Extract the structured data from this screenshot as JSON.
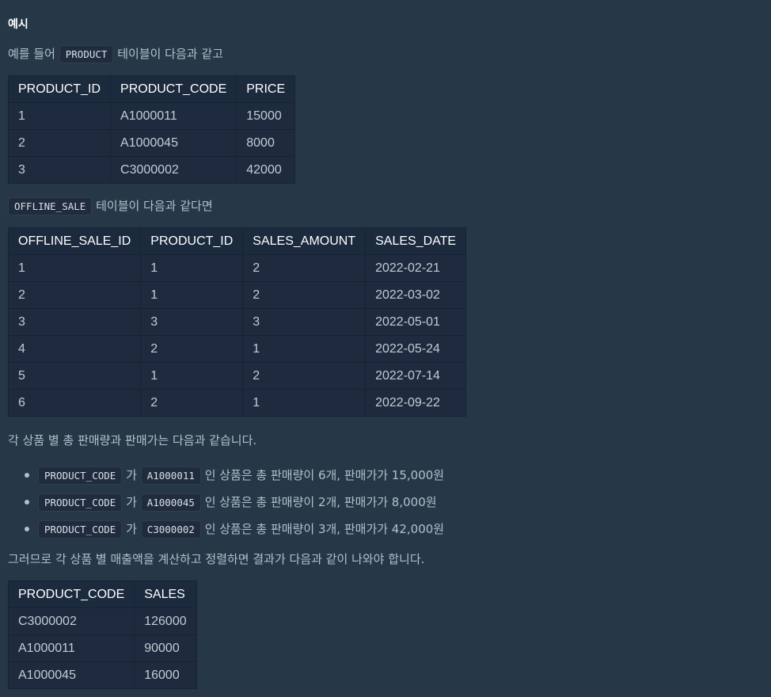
{
  "section_title": "예시",
  "intro": {
    "before": "예를 들어",
    "code": "PRODUCT",
    "after": "테이블이 다음과 같고"
  },
  "product_table": {
    "headers": [
      "PRODUCT_ID",
      "PRODUCT_CODE",
      "PRICE"
    ],
    "rows": [
      [
        "1",
        "A1000011",
        "15000"
      ],
      [
        "2",
        "A1000045",
        "8000"
      ],
      [
        "3",
        "C3000002",
        "42000"
      ]
    ]
  },
  "offline_intro": {
    "code": "OFFLINE_SALE",
    "after": "테이블이 다음과 같다면"
  },
  "offline_table": {
    "headers": [
      "OFFLINE_SALE_ID",
      "PRODUCT_ID",
      "SALES_AMOUNT",
      "SALES_DATE"
    ],
    "rows": [
      [
        "1",
        "1",
        "2",
        "2022-02-21"
      ],
      [
        "2",
        "1",
        "2",
        "2022-03-02"
      ],
      [
        "3",
        "3",
        "3",
        "2022-05-01"
      ],
      [
        "4",
        "2",
        "1",
        "2022-05-24"
      ],
      [
        "5",
        "1",
        "2",
        "2022-07-14"
      ],
      [
        "6",
        "2",
        "1",
        "2022-09-22"
      ]
    ]
  },
  "summary_text": "각 상품 별 총 판매량과 판매가는 다음과 같습니다.",
  "bullets": [
    {
      "code1": "PRODUCT_CODE",
      "mid": "가",
      "code2": "A1000011",
      "text": "인 상품은 총 판매량이 6개, 판매가가 15,000원"
    },
    {
      "code1": "PRODUCT_CODE",
      "mid": "가",
      "code2": "A1000045",
      "text": "인 상품은 총 판매량이 2개, 판매가가 8,000원"
    },
    {
      "code1": "PRODUCT_CODE",
      "mid": "가",
      "code2": "C3000002",
      "text": "인 상품은 총 판매량이 3개, 판매가가 42,000원"
    }
  ],
  "conclusion_text": "그러므로 각 상품 별 매출액을 계산하고 정렬하면 결과가 다음과 같이 나와야 합니다.",
  "result_table": {
    "headers": [
      "PRODUCT_CODE",
      "SALES"
    ],
    "rows": [
      [
        "C3000002",
        "126000"
      ],
      [
        "A1000011",
        "90000"
      ],
      [
        "A1000045",
        "16000"
      ]
    ]
  }
}
